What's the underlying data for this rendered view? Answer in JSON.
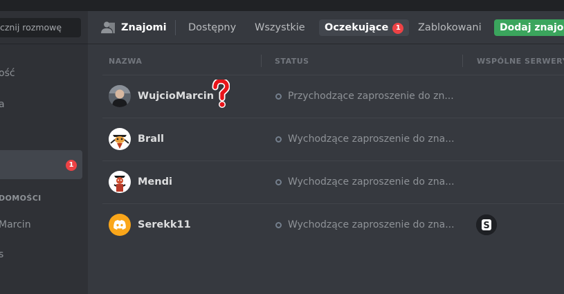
{
  "sidebar": {
    "search_placeholder": "cznij rozmowę",
    "items": [
      {
        "label": "ość"
      },
      {
        "label": "a"
      },
      {
        "label": "",
        "badge": "1"
      }
    ],
    "dm_header": "DOMOŚCI",
    "dms": [
      {
        "label": "Marcin"
      },
      {
        "label": "s"
      }
    ]
  },
  "topbar": {
    "title": "Znajomi",
    "tabs": [
      {
        "label": "Dostępny"
      },
      {
        "label": "Wszystkie"
      },
      {
        "label": "Oczekujące",
        "badge": "1",
        "active": true
      },
      {
        "label": "Zablokowani"
      }
    ],
    "add_button": "Dodaj znajomego"
  },
  "columns": {
    "name": "NAZWA",
    "status": "STATUS",
    "servers": "WSPÓLNE SERWERY"
  },
  "rows": [
    {
      "name": "WujcioMarcin",
      "status": "Przychodzące zaproszenie do zn...",
      "avatar": "photo-avatar"
    },
    {
      "name": "Brall",
      "status": "Wychodzące zaproszenie do zna...",
      "avatar": "cartoon-avatar"
    },
    {
      "name": "Mendi",
      "status": "Wychodzące zaproszenie do zna...",
      "avatar": "cartoon-avatar"
    },
    {
      "name": "Serekk11",
      "status": "Wychodzące zaproszenie do zna...",
      "avatar": "discord-default-avatar",
      "server_icon": "S"
    }
  ],
  "colors": {
    "accent_green": "#3ba55d",
    "badge_red": "#ed4245",
    "question_mark": "#e8141a",
    "discord_orange": "#faa61a"
  }
}
